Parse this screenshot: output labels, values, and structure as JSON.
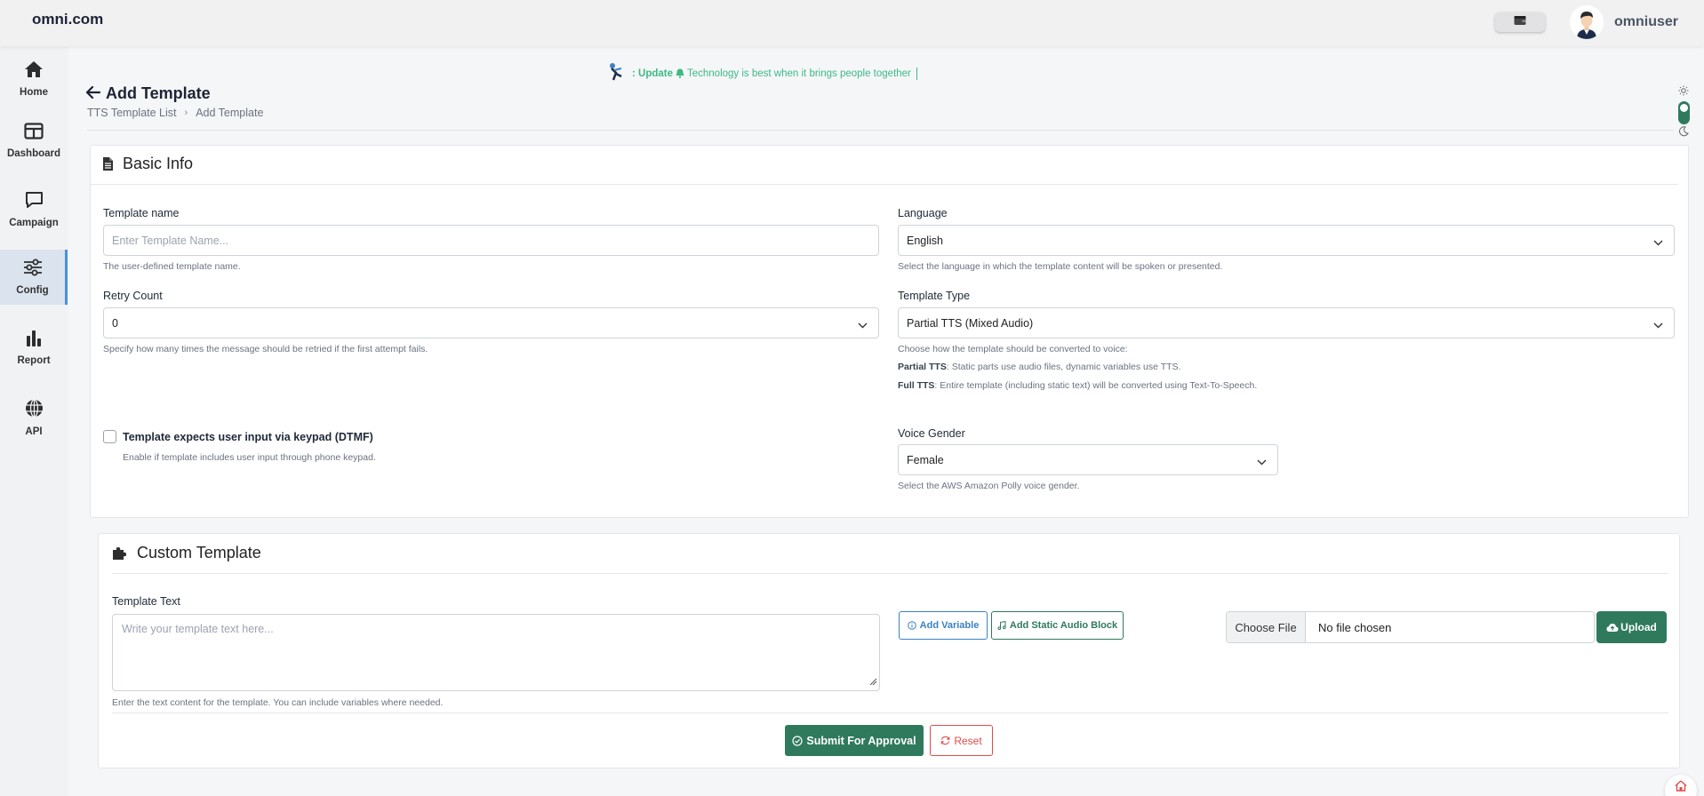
{
  "app": {
    "brand": "omni.com",
    "username": "omniuser"
  },
  "icons": {
    "wallet": "wallet-icon",
    "avatar": "user-avatar",
    "back": "arrow-left-icon",
    "doc": "file-text-icon",
    "puzzle": "puzzle-icon",
    "sun": "sun-icon",
    "moon": "moon-icon",
    "bell": "bell-icon",
    "info": "info-circle-icon",
    "music": "music-note-icon",
    "cloud": "cloud-upload-icon",
    "check": "check-circle-icon",
    "reset": "refresh-icon"
  },
  "colors": {
    "primary": "#2f7a5d",
    "accent_blue": "#3b82c4",
    "danger": "#e24b4b",
    "ticker": "#3cba84"
  },
  "sidebar": {
    "items": [
      {
        "label": "Home",
        "icon": "home-icon"
      },
      {
        "label": "Dashboard",
        "icon": "dashboard-icon"
      },
      {
        "label": "Campaign",
        "icon": "chat-icon"
      },
      {
        "label": "Config",
        "icon": "sliders-icon",
        "active": true
      },
      {
        "label": "Report",
        "icon": "bar-chart-icon"
      },
      {
        "label": "API",
        "icon": "globe-icon"
      }
    ]
  },
  "ticker": {
    "prefix": ": Update",
    "message": "Technology is best when it brings people together"
  },
  "page": {
    "title": "Add Template",
    "breadcrumb": [
      "TTS Template List",
      "Add Template"
    ]
  },
  "basic_info": {
    "heading": "Basic Info",
    "template_name": {
      "label": "Template name",
      "placeholder": "Enter Template Name...",
      "help": "The user-defined template name."
    },
    "language": {
      "label": "Language",
      "value": "English",
      "help": "Select the language in which the template content will be spoken or presented."
    },
    "retry_count": {
      "label": "Retry Count",
      "value": "0",
      "help": "Specify how many times the message should be retried if the first attempt fails."
    },
    "template_type": {
      "label": "Template Type",
      "value": "Partial TTS (Mixed Audio)",
      "help": "Choose how the template should be converted to voice:",
      "partial_label": "Partial TTS",
      "partial_text": ": Static parts use audio files, dynamic variables use TTS.",
      "full_label": "Full TTS",
      "full_text": ": Entire template (including static text) will be converted using Text-To-Speech."
    },
    "dtmf": {
      "label": "Template expects user input via keypad (DTMF)",
      "help": "Enable if template includes user input through phone keypad."
    },
    "voice_gender": {
      "label": "Voice Gender",
      "value": "Female",
      "help": "Select the AWS Amazon Polly voice gender."
    }
  },
  "custom_template": {
    "heading": "Custom Template",
    "text_label": "Template Text",
    "text_placeholder": "Write your template text here...",
    "text_help": "Enter the text content for the template. You can include variables where needed.",
    "add_variable": "Add Variable",
    "add_static_audio": "Add Static Audio Block",
    "choose_file": "Choose File",
    "no_file": "No file chosen",
    "upload": "Upload",
    "submit": "Submit For Approval",
    "reset": "Reset"
  }
}
